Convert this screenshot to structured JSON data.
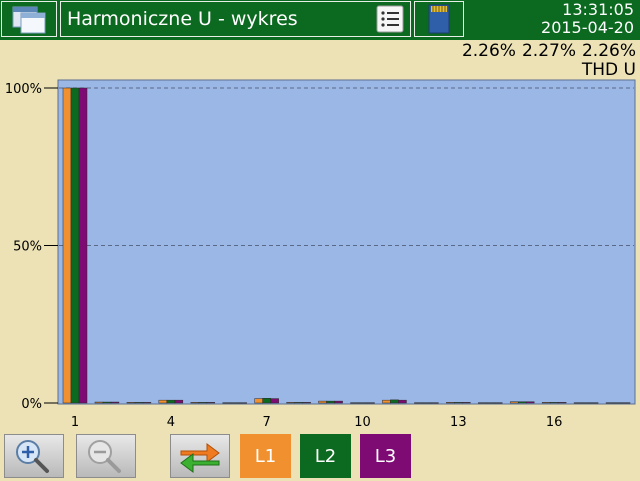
{
  "header": {
    "title": "Harmoniczne U - wykres",
    "time": "13:31:05",
    "date": "2015-04-20",
    "icons": [
      "windows-icon",
      "list-icon",
      "sd-card-icon"
    ]
  },
  "thd": {
    "values": [
      "2.26%",
      "2.27%",
      "2.26%"
    ],
    "label": "THD U"
  },
  "buttons": {
    "zoom_in": "zoom-in-icon",
    "zoom_out": "zoom-out-icon",
    "swap": "swap-icon",
    "phases": [
      "L1",
      "L2",
      "L3"
    ]
  },
  "colors": {
    "background": "#ece2b6",
    "header": "#0c6a20",
    "plot": "#9bb7e6",
    "L1": "#f0902e",
    "L2": "#0c6a20",
    "L3": "#7e0a74"
  },
  "chart_data": {
    "type": "bar",
    "categories": [
      "1",
      "2",
      "3",
      "4",
      "5",
      "6",
      "7",
      "8",
      "9",
      "10",
      "11",
      "12",
      "13",
      "14",
      "15",
      "16",
      "17",
      "18"
    ],
    "tick_labels": [
      "1",
      "4",
      "7",
      "10",
      "13",
      "16"
    ],
    "y_tick_labels": [
      "100%",
      "50%",
      "0%"
    ],
    "ylim": [
      0,
      100
    ],
    "grid": true,
    "series": [
      {
        "name": "L1",
        "values": [
          100,
          0.3,
          0.2,
          0.9,
          0.2,
          0.1,
          1.4,
          0.2,
          0.6,
          0.1,
          0.9,
          0.1,
          0.2,
          0.1,
          0.4,
          0.2,
          0.1,
          0.1
        ]
      },
      {
        "name": "L2",
        "values": [
          100,
          0.3,
          0.2,
          0.9,
          0.2,
          0.1,
          1.5,
          0.2,
          0.6,
          0.1,
          1.0,
          0.1,
          0.2,
          0.1,
          0.4,
          0.2,
          0.1,
          0.1
        ]
      },
      {
        "name": "L3",
        "values": [
          100,
          0.3,
          0.2,
          0.9,
          0.2,
          0.1,
          1.4,
          0.2,
          0.6,
          0.1,
          0.9,
          0.1,
          0.2,
          0.1,
          0.4,
          0.2,
          0.1,
          0.1
        ]
      }
    ]
  }
}
